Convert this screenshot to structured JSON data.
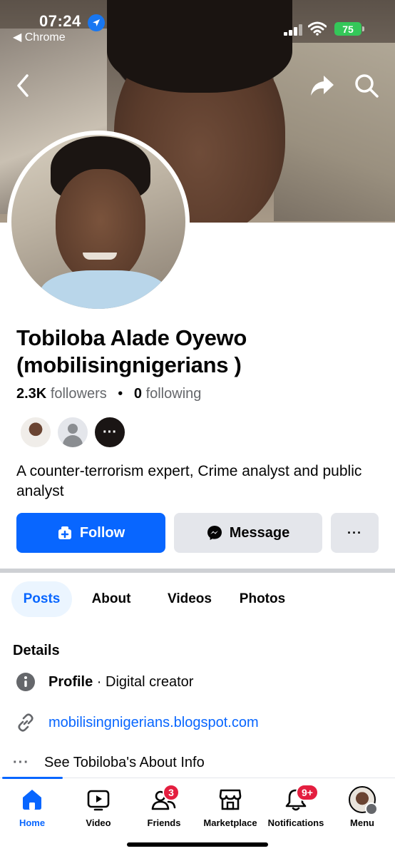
{
  "status_bar": {
    "time": "07:24",
    "back_app": "◀ Chrome",
    "battery": "75"
  },
  "profile": {
    "name": "Tobiloba Alade Oyewo (mobilisingnigerians )",
    "followers_count": "2.3K",
    "followers_label": "followers",
    "separator": "•",
    "following_count": "0",
    "following_label": "following",
    "bio": "A counter-terrorism expert, Crime analyst and public analyst"
  },
  "actions": {
    "follow_label": "Follow",
    "message_label": "Message",
    "more_label": "···"
  },
  "tabs": [
    {
      "label": "Posts",
      "active": true
    },
    {
      "label": "About",
      "active": false
    },
    {
      "label": "Videos",
      "active": false
    },
    {
      "label": "Photos",
      "active": false
    }
  ],
  "details": {
    "title": "Details",
    "profile_label": "Profile",
    "profile_sep": " · ",
    "profile_value": "Digital creator",
    "link": "mobilisingnigerians.blogspot.com",
    "about_dots": "···",
    "about_info": "See Tobiloba's About Info"
  },
  "bottom_nav": {
    "items": [
      {
        "label": "Home",
        "icon": "home-icon",
        "active": true
      },
      {
        "label": "Video",
        "icon": "video-icon"
      },
      {
        "label": "Friends",
        "icon": "friends-icon",
        "badge": "3"
      },
      {
        "label": "Marketplace",
        "icon": "marketplace-icon"
      },
      {
        "label": "Notifications",
        "icon": "bell-icon",
        "badge": "9+"
      },
      {
        "label": "Menu",
        "icon": "avatar"
      }
    ]
  },
  "colors": {
    "accent": "#0866ff",
    "badge": "#e41e3f",
    "button_secondary": "#e4e6eb"
  }
}
